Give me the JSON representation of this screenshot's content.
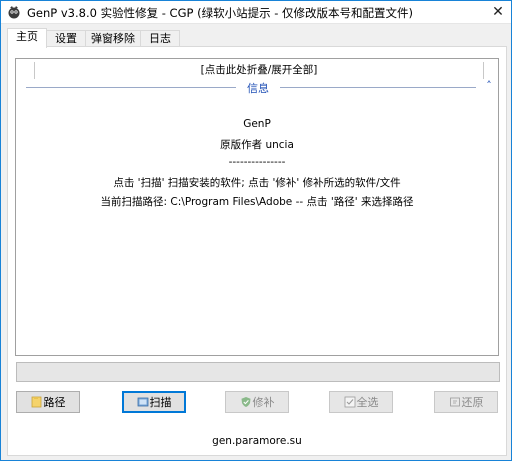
{
  "window": {
    "title": "GenP v3.8.0 实验性修复 - CGP (绿软小站提示 - 仅修改版本号和配置文件)",
    "close_glyph": "✕"
  },
  "tabs": [
    {
      "label": "主页"
    },
    {
      "label": "设置"
    },
    {
      "label": "弹窗移除"
    },
    {
      "label": "日志"
    }
  ],
  "main": {
    "collapse_label": "[点击此处折叠/展开全部]",
    "section_title": "信息",
    "chevron_glyph": "˄",
    "lines": [
      "GenP",
      "原版作者 uncia",
      "---------------",
      "点击 '扫描' 扫描安装的软件; 点击 '修补' 修补所选的软件/文件",
      "当前扫描路径: C:\\Program Files\\Adobe -- 点击 '路径' 来选择路径"
    ],
    "progress": 0
  },
  "buttons": {
    "path": "路径",
    "scan": "扫描",
    "patch": "修补",
    "select_all": "全选",
    "restore": "还原"
  },
  "footer": {
    "link": "gen.paramore.su"
  },
  "colors": {
    "accent": "#0078d7",
    "section_title": "#1f4fb5"
  }
}
